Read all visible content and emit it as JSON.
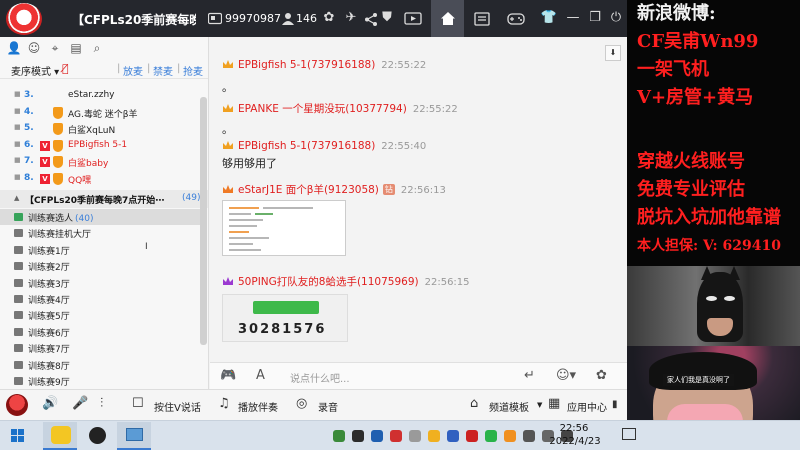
{
  "titlebar": {
    "title": "【CFPLs20季前赛每晚7",
    "room_id": "99970987",
    "user_count": "146"
  },
  "left_panel": {
    "mode_label": "麦序模式",
    "actions": [
      "放麦",
      "禁麦",
      "抢麦"
    ],
    "queue": [
      {
        "num": "3.",
        "name": "eStar.zzhy",
        "color": "dark",
        "medal": false,
        "v": false
      },
      {
        "num": "4.",
        "name": "AG.毒蛇 迷个β羊",
        "color": "dark",
        "medal": true,
        "v": false
      },
      {
        "num": "5.",
        "name": "白鲨XqLuN",
        "color": "dark",
        "medal": true,
        "v": false
      },
      {
        "num": "6.",
        "name": "EPBigfish 5-1",
        "color": "red",
        "medal": true,
        "v": true
      },
      {
        "num": "7.",
        "name": "白鲨baby",
        "color": "red",
        "medal": true,
        "v": true
      },
      {
        "num": "8.",
        "name": "QQ嘿",
        "color": "red",
        "medal": true,
        "v": true
      }
    ],
    "channel": {
      "name": "【CFPLs20季前赛每晚7点开始⋯",
      "count": "(49)"
    },
    "sub_channels": [
      {
        "name": "训练赛选人",
        "count": "(40)",
        "selected": true
      },
      {
        "name": "训练赛挂机大厅",
        "count": "",
        "selected": false
      },
      {
        "name": "训练赛1厅",
        "count": "",
        "selected": false
      },
      {
        "name": "训练赛2厅",
        "count": "",
        "selected": false
      },
      {
        "name": "训练赛3厅",
        "count": "",
        "selected": false
      },
      {
        "name": "训练赛4厅",
        "count": "",
        "selected": false
      },
      {
        "name": "训练赛5厅",
        "count": "",
        "selected": false
      },
      {
        "name": "训练赛6厅",
        "count": "",
        "selected": false
      },
      {
        "name": "训练赛7厅",
        "count": "",
        "selected": false
      },
      {
        "name": "训练赛8厅",
        "count": "",
        "selected": false
      },
      {
        "name": "训练赛9厅",
        "count": "",
        "selected": false
      }
    ]
  },
  "chat": {
    "messages": [
      {
        "user": "EPBigfish 5-1(737916188)",
        "time": "22:55:22",
        "body": "。",
        "crown": "gold"
      },
      {
        "user": "EPANKE 一个星期没玩(10377794)",
        "time": "22:55:22",
        "body": "。",
        "crown": "gold"
      },
      {
        "user": "EPBigfish 5-1(737916188)",
        "time": "22:55:40",
        "body": "够用够用了",
        "crown": "gold"
      },
      {
        "user": "eStarJ1E 面个β羊(9123058)",
        "time": "22:56:13",
        "body": "",
        "crown": "orange",
        "rank": "钻"
      },
      {
        "user": "50PING打队友的8蛤选手(11075969)",
        "time": "22:56:15",
        "body": "",
        "crown": "purple"
      }
    ],
    "captcha_code": "30281576",
    "input_placeholder": "说点什么吧..."
  },
  "bottombar": {
    "press_to_talk": "按住V说话",
    "accompany": "播放伴奏",
    "record": "录音",
    "channel_template": "频道模板",
    "app_center": "应用中心"
  },
  "taskbar": {
    "time": "22:56",
    "date": "2022/4/23"
  },
  "overlay": {
    "lines_white": [
      "新浪微博:"
    ],
    "lines_red_top": [
      "CF吴甫Wn99",
      "一架飞机",
      "V+房管+黄马"
    ],
    "lines_red_mid": [
      "穿越火线账号",
      "免费专业评估",
      "脱坑入坑加他靠谱",
      "本人担保: V: 629410"
    ],
    "cam_caption": "家人们我是真没啊了"
  },
  "colors": {
    "accent_blue": "#3b7fd9",
    "name_red": "#e02020",
    "titlebar_bg": "#25272d",
    "overlay_red": "#ff1f1f"
  }
}
